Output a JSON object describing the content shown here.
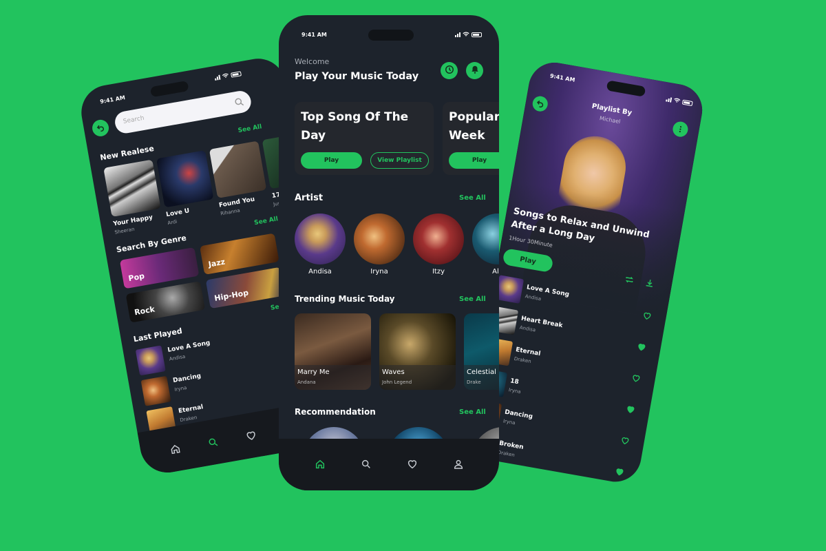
{
  "colors": {
    "background": "#22c35e",
    "accent": "#22c35e",
    "phone_bg": "#1d232c",
    "nav_bg": "#16191e"
  },
  "left_phone": {
    "status_time": "9:41 AM",
    "search_placeholder": "Search",
    "new_release": {
      "title": "New Realese",
      "see_all": "See All",
      "items": [
        {
          "title": "Your Happy",
          "artist": "Sheeran",
          "image": "img-piano"
        },
        {
          "title": "Love U",
          "artist": "Ardi",
          "image": "img-dj"
        },
        {
          "title": "Found You",
          "artist": "Rihanna",
          "image": "img-headphones"
        },
        {
          "title": "17",
          "artist": "Just",
          "image": "img-green"
        }
      ]
    },
    "genre": {
      "title": "Search By Genre",
      "see_all": "See All",
      "items": [
        {
          "label": "Pop",
          "image": "img-pop"
        },
        {
          "label": "Jazz",
          "image": "img-jazz"
        },
        {
          "label": "Rock",
          "image": "img-rock"
        },
        {
          "label": "Hip-Hop",
          "image": "img-hiphop"
        }
      ]
    },
    "last_played": {
      "title": "Last Played",
      "see_all": "See",
      "items": [
        {
          "title": "Love A Song",
          "artist": "Andisa",
          "image": "img-singer"
        },
        {
          "title": "Dancing",
          "artist": "Iryna",
          "image": "img-iryna"
        },
        {
          "title": "Eternal",
          "artist": "Draken",
          "image": "img-sunset"
        }
      ]
    },
    "nav": [
      {
        "icon": "home-icon",
        "active": false
      },
      {
        "icon": "search-icon",
        "active": true
      },
      {
        "icon": "heart-icon",
        "active": false
      }
    ]
  },
  "center_phone": {
    "status_time": "9:41 AM",
    "welcome": "Welcome",
    "title": "Play Your Music Today",
    "featured": [
      {
        "title": "Top Song Of The Day",
        "play": "Play",
        "view": "View Playlist"
      },
      {
        "title": "Popular In The Week",
        "play": "Play"
      }
    ],
    "artist": {
      "title": "Artist",
      "see_all": "See All",
      "items": [
        {
          "name": "Andisa",
          "image": "img-singer"
        },
        {
          "name": "Iryna",
          "image": "img-iryna"
        },
        {
          "name": "Itzy",
          "image": "img-itzy"
        },
        {
          "name": "Ale",
          "image": "img-teal"
        }
      ]
    },
    "trending": {
      "title": "Trending Music Today",
      "see_all": "See All",
      "items": [
        {
          "title": "Marry Me",
          "artist": "Andana",
          "image": "img-orchestra"
        },
        {
          "title": "Waves",
          "artist": "John Legend",
          "image": "img-drums"
        },
        {
          "title": "Celestial",
          "artist": "Drake",
          "image": "img-celestial"
        }
      ]
    },
    "recommendation": {
      "title": "Recommendation",
      "see_all": "See All",
      "images": [
        "img-rec1",
        "img-rec2",
        "img-rec3"
      ]
    },
    "nav": [
      {
        "icon": "home-icon",
        "active": true
      },
      {
        "icon": "search-icon",
        "active": false
      },
      {
        "icon": "heart-icon",
        "active": false
      },
      {
        "icon": "user-icon",
        "active": false
      }
    ]
  },
  "right_phone": {
    "status_time": "9:41 AM",
    "playlist_by": "Playlist By",
    "owner": "Michael",
    "title": "Songs to Relax and Unwind After a Long Day",
    "duration": "1Hour 30Minute",
    "play": "Play",
    "songs": [
      {
        "title": "Love A Song",
        "artist": "Andisa",
        "image": "img-singer",
        "liked": false
      },
      {
        "title": "Heart Break",
        "artist": "Andisa",
        "image": "img-piano",
        "liked": true
      },
      {
        "title": "Eternal",
        "artist": "Draken",
        "image": "img-sunset",
        "liked": false
      },
      {
        "title": "18",
        "artist": "Iryna",
        "image": "img-teal",
        "liked": true
      },
      {
        "title": "Dancing",
        "artist": "Iryna",
        "image": "img-iryna",
        "liked": false
      },
      {
        "title": "Broken",
        "artist": "Draken",
        "image": "img-stage",
        "liked": true
      }
    ]
  }
}
